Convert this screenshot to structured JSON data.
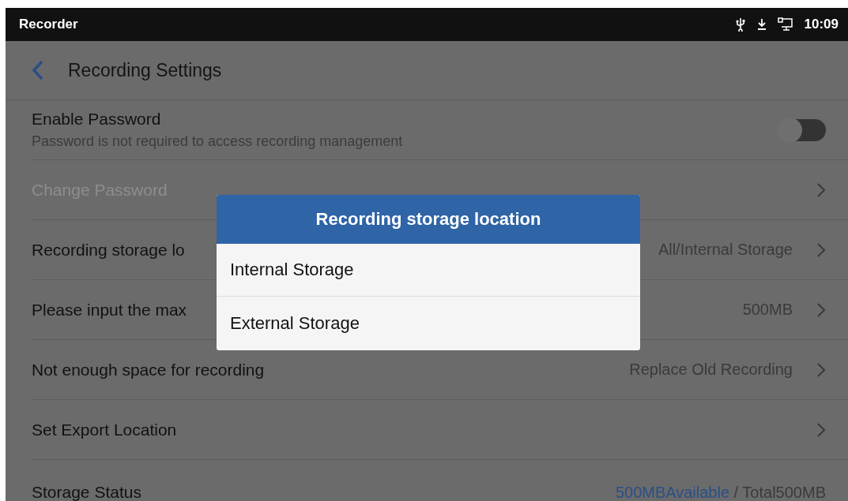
{
  "status_bar": {
    "app_name": "Recorder",
    "time": "10:09"
  },
  "header": {
    "title": "Recording Settings"
  },
  "rows": [
    {
      "kind": "toggle",
      "label": "Enable Password",
      "description": "Password is not required to access recording management",
      "on": false,
      "disabled": false
    },
    {
      "kind": "link",
      "label": "Change Password",
      "disabled": true
    },
    {
      "kind": "link",
      "label": "Recording storage lo",
      "value": "All/Internal Storage",
      "disabled": false
    },
    {
      "kind": "link",
      "label": "Please input the max",
      "value": "500MB",
      "disabled": false
    },
    {
      "kind": "link",
      "label": "Not enough space for recording",
      "value": "Replace Old Recording",
      "disabled": false
    },
    {
      "kind": "link",
      "label": "Set Export Location",
      "disabled": false
    },
    {
      "kind": "status",
      "label": "Storage Status",
      "available": "500MBAvailable",
      "total": " / Total500MB",
      "disabled": false
    }
  ],
  "dialog": {
    "title": "Recording storage location",
    "options": [
      {
        "label": "Internal Storage"
      },
      {
        "label": "External Storage"
      }
    ]
  }
}
